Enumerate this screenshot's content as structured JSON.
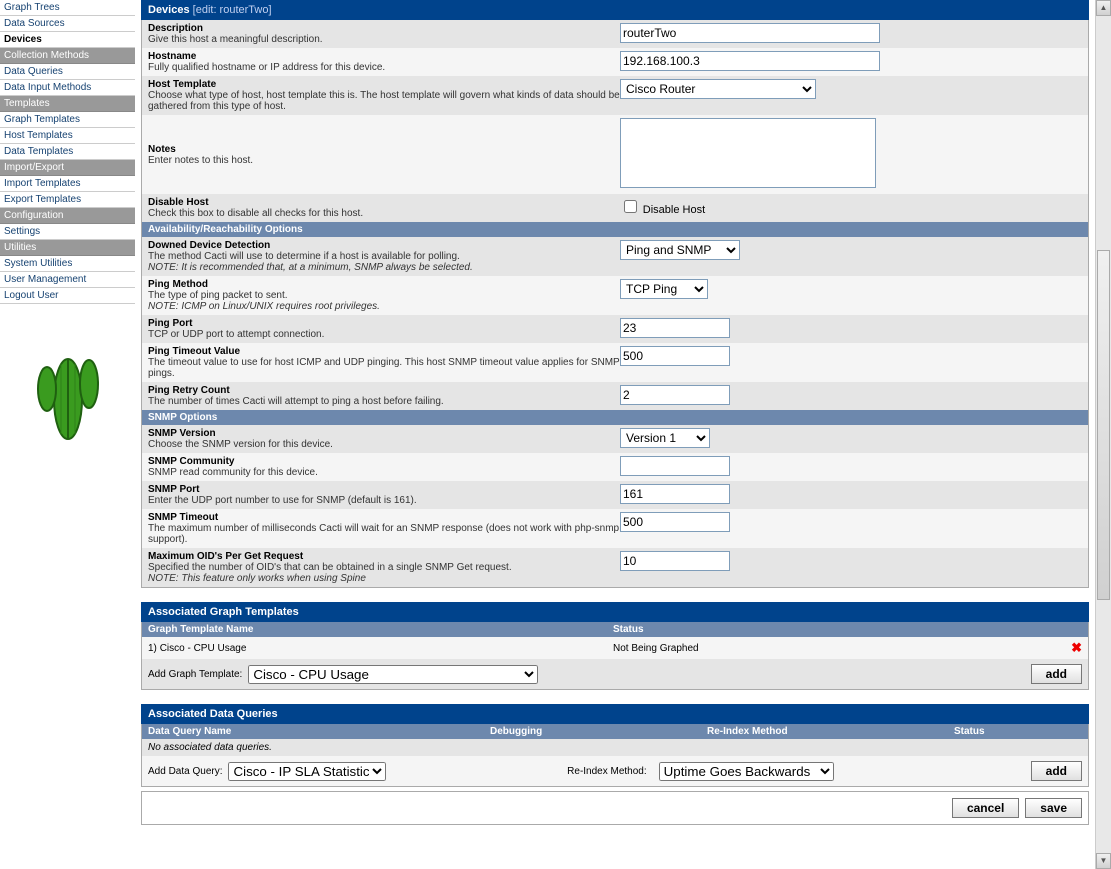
{
  "sidebar": {
    "items": [
      {
        "type": "link",
        "label": "Graph Trees"
      },
      {
        "type": "link",
        "label": "Data Sources"
      },
      {
        "type": "link",
        "label": "Devices",
        "active": true
      },
      {
        "type": "header",
        "label": "Collection Methods"
      },
      {
        "type": "link",
        "label": "Data Queries"
      },
      {
        "type": "link",
        "label": "Data Input Methods"
      },
      {
        "type": "header",
        "label": "Templates"
      },
      {
        "type": "link",
        "label": "Graph Templates"
      },
      {
        "type": "link",
        "label": "Host Templates"
      },
      {
        "type": "link",
        "label": "Data Templates"
      },
      {
        "type": "header",
        "label": "Import/Export"
      },
      {
        "type": "link",
        "label": "Import Templates"
      },
      {
        "type": "link",
        "label": "Export Templates"
      },
      {
        "type": "header",
        "label": "Configuration"
      },
      {
        "type": "link",
        "label": "Settings"
      },
      {
        "type": "header",
        "label": "Utilities"
      },
      {
        "type": "link",
        "label": "System Utilities"
      },
      {
        "type": "link",
        "label": "User Management"
      },
      {
        "type": "link",
        "label": "Logout User"
      }
    ]
  },
  "panel": {
    "title": "Devices",
    "edit": "[edit: routerTwo]"
  },
  "fields": {
    "description": {
      "title": "Description",
      "desc": "Give this host a meaningful description.",
      "value": "routerTwo"
    },
    "hostname": {
      "title": "Hostname",
      "desc": "Fully qualified hostname or IP address for this device.",
      "value": "192.168.100.3"
    },
    "host_template": {
      "title": "Host Template",
      "desc": "Choose what type of host, host template this is. The host template will govern what kinds of data should be gathered from this type of host.",
      "value": "Cisco Router"
    },
    "notes": {
      "title": "Notes",
      "desc": "Enter notes to this host.",
      "value": ""
    },
    "disable_host": {
      "title": "Disable Host",
      "desc": "Check this box to disable all checks for this host.",
      "checkbox_label": "Disable Host"
    }
  },
  "avail_header": "Availability/Reachability Options",
  "avail": {
    "downed": {
      "title": "Downed Device Detection",
      "desc": "The method Cacti will use to determine if a host is available for polling.",
      "note": "NOTE: It is recommended that, at a minimum, SNMP always be selected.",
      "value": "Ping and SNMP"
    },
    "ping_method": {
      "title": "Ping Method",
      "desc": "The type of ping packet to sent.",
      "note": "NOTE: ICMP on Linux/UNIX requires root privileges.",
      "value": "TCP Ping"
    },
    "ping_port": {
      "title": "Ping Port",
      "desc": "TCP or UDP port to attempt connection.",
      "value": "23"
    },
    "ping_timeout": {
      "title": "Ping Timeout Value",
      "desc": "The timeout value to use for host ICMP and UDP pinging. This host SNMP timeout value applies for SNMP pings.",
      "value": "500"
    },
    "ping_retry": {
      "title": "Ping Retry Count",
      "desc": "The number of times Cacti will attempt to ping a host before failing.",
      "value": "2"
    }
  },
  "snmp_header": "SNMP Options",
  "snmp": {
    "version": {
      "title": "SNMP Version",
      "desc": "Choose the SNMP version for this device.",
      "value": "Version 1"
    },
    "community": {
      "title": "SNMP Community",
      "desc": "SNMP read community for this device.",
      "value": ""
    },
    "port": {
      "title": "SNMP Port",
      "desc": "Enter the UDP port number to use for SNMP (default is 161).",
      "value": "161"
    },
    "timeout": {
      "title": "SNMP Timeout",
      "desc": "The maximum number of milliseconds Cacti will wait for an SNMP response (does not work with php-snmp support).",
      "value": "500"
    },
    "maxoid": {
      "title": "Maximum OID's Per Get Request",
      "desc": "Specified the number of OID's that can be obtained in a single SNMP Get request.",
      "note": "NOTE: This feature only works when using Spine",
      "value": "10"
    }
  },
  "graph_templates": {
    "header": "Associated Graph Templates",
    "col_name": "Graph Template Name",
    "col_status": "Status",
    "row_idx": "1)",
    "row_name": "Cisco - CPU Usage",
    "row_status": "Not Being Graphed",
    "add_label": "Add Graph Template:",
    "add_value": "Cisco - CPU Usage",
    "add_btn": "add"
  },
  "data_queries": {
    "header": "Associated Data Queries",
    "col_name": "Data Query Name",
    "col_debug": "Debugging",
    "col_reindex": "Re-Index Method",
    "col_status": "Status",
    "empty": "No associated data queries.",
    "add_label": "Add Data Query:",
    "add_value": "Cisco - IP SLA Statistics",
    "reindex_label": "Re-Index Method:",
    "reindex_value": "Uptime Goes Backwards",
    "add_btn": "add"
  },
  "footer": {
    "cancel": "cancel",
    "save": "save"
  }
}
